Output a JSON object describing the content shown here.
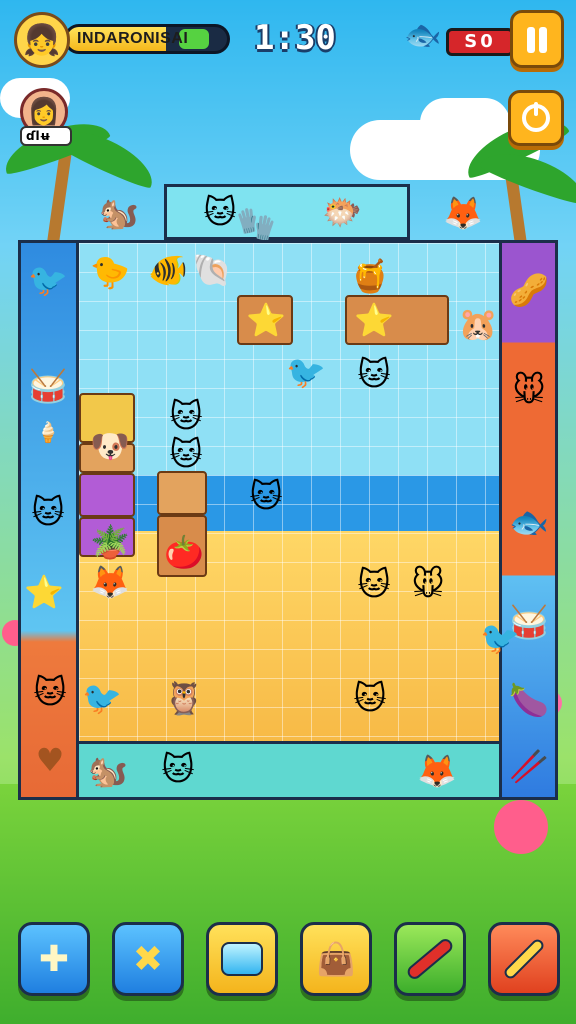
{
  "hud": {
    "player_name": "INDARONISAI",
    "player_avatar_icon": "girl-avatar-icon",
    "name_bar_fill": 0.62,
    "timer": "1:30",
    "score": "S0",
    "score_icon": "blue-fish-icon",
    "pause_icon": "pause-icon",
    "power_icon": "power-icon"
  },
  "opponent": {
    "tag": "ɗlʉ",
    "avatar_icon": "red-hair-girl-avatar-icon"
  },
  "board": {
    "top_row_pieces": [
      "grey-cat",
      "white-glove",
      "pink-pufferfish"
    ],
    "left_column_pieces": [
      "blue-bird",
      "drum",
      "ice-cream",
      "blue-cat",
      "star",
      "orange-cat",
      "heart"
    ],
    "right_column_pieces": [
      "brown-bean",
      "tan-mouse",
      "pickle-fish",
      "drum",
      "purple-bean",
      "crossed-sticks"
    ],
    "bottom_row_pieces": [
      "brown-squirrel",
      "purple-cat",
      "fox-duo"
    ]
  },
  "toolbar": {
    "buttons": [
      {
        "name": "plus-tool",
        "icon": "plus-icon",
        "glyph": "✚",
        "color": "blue"
      },
      {
        "name": "cross-tool",
        "icon": "cross-icon",
        "glyph": "✖",
        "color": "blue"
      },
      {
        "name": "gem-tool",
        "icon": "blue-gem-icon",
        "glyph": "◆",
        "color": "yellow"
      },
      {
        "name": "bag-tool",
        "icon": "bag-icon",
        "glyph": "👜",
        "color": "yellow"
      },
      {
        "name": "brush-tool",
        "icon": "red-brush-icon",
        "glyph": "✎",
        "color": "green"
      },
      {
        "name": "dropper-tool",
        "icon": "dropper-icon",
        "glyph": "✑",
        "color": "red"
      }
    ]
  },
  "colors": {
    "sky": "#2fb7ef",
    "grass": "#5ec43a",
    "accent": "#ffb51e",
    "board_border": "#1b2e4a"
  }
}
